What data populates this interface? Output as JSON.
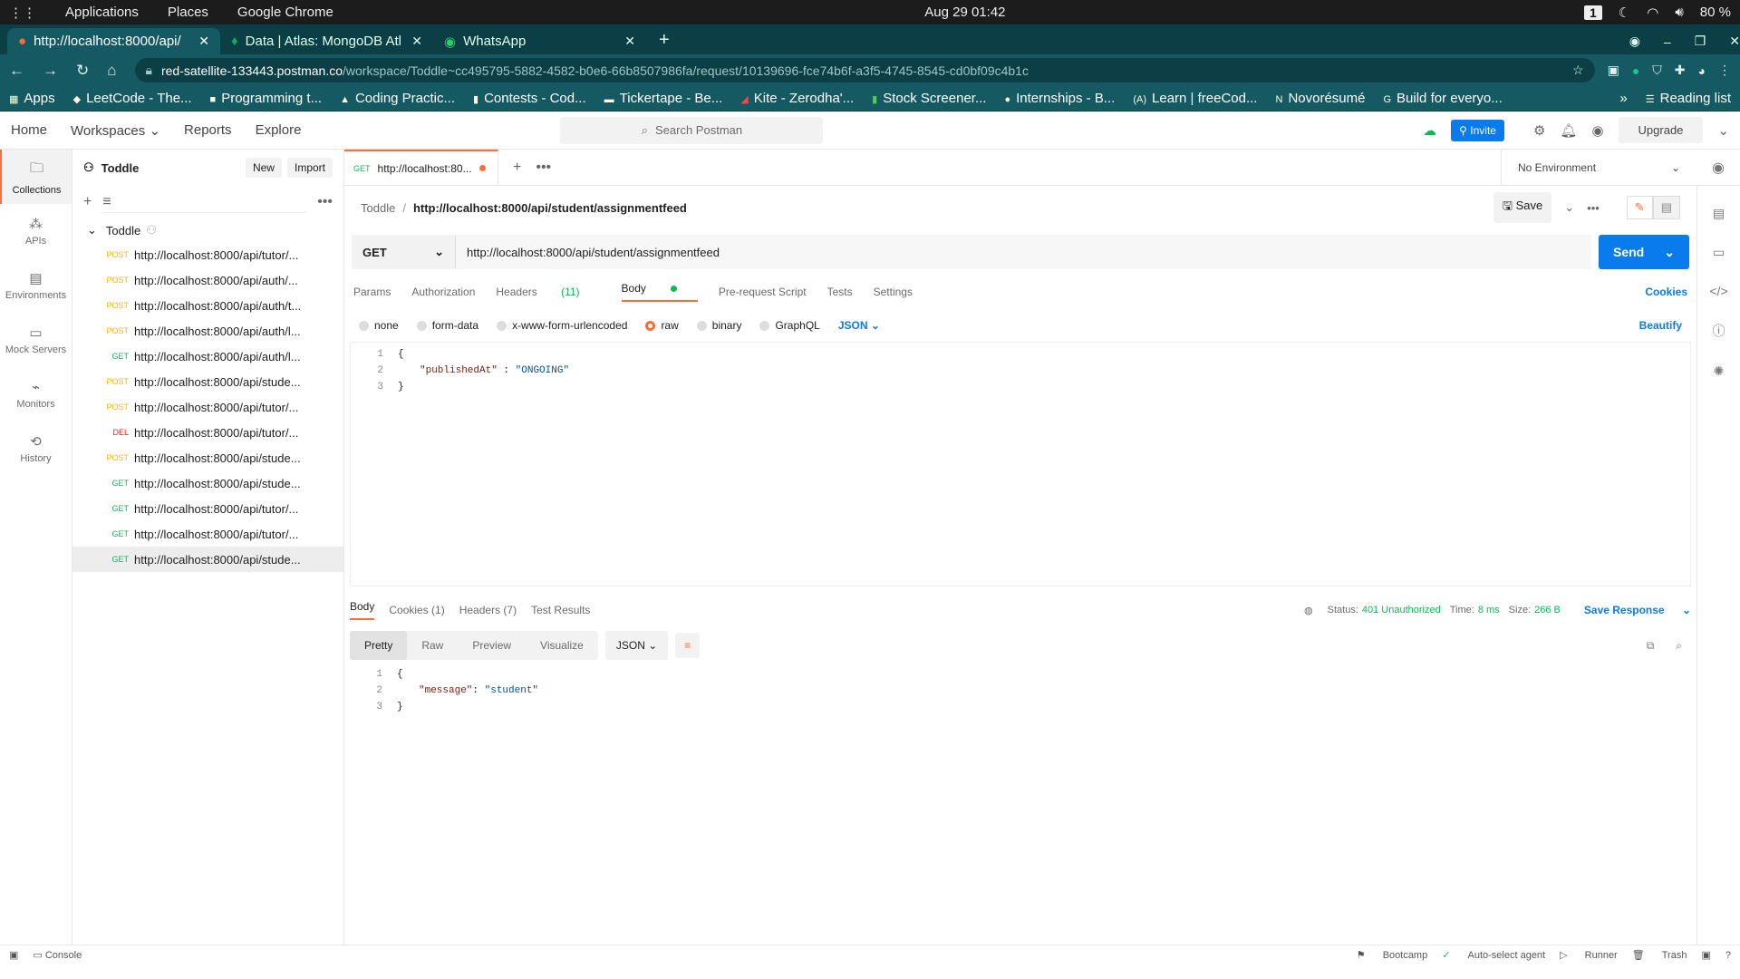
{
  "system": {
    "menu": [
      "Applications",
      "Places",
      "Google Chrome"
    ],
    "datetime": "Aug 29  01:42",
    "workspace": "1",
    "battery": "80 %"
  },
  "browser": {
    "tabs": [
      {
        "title": "http://localhost:8000/api/",
        "active": true
      },
      {
        "title": "Data | Atlas: MongoDB Atl",
        "active": false
      },
      {
        "title": "WhatsApp",
        "active": false
      }
    ],
    "url_host": "red-satellite-133443.postman.co",
    "url_path": "/workspace/Toddle~cc495795-5882-4582-b0e6-66b8507986fa/request/10139696-fce74b6f-a3f5-4745-8545-cd0bf09c4b1c",
    "bookmarks": [
      "Apps",
      "LeetCode - The...",
      "Programming t...",
      "Coding Practic...",
      "Contests - Cod...",
      "Tickertape - Be...",
      "Kite - Zerodha'...",
      "Stock Screener...",
      "Internships - B...",
      "Learn | freeCod...",
      "Novorésumé",
      "Build for everyo..."
    ],
    "reading_list": "Reading list"
  },
  "postman": {
    "nav": [
      "Home",
      "Workspaces",
      "Reports",
      "Explore"
    ],
    "search_placeholder": "Search Postman",
    "invite": "Invite",
    "upgrade": "Upgrade",
    "rail": [
      "Collections",
      "APIs",
      "Environments",
      "Mock Servers",
      "Monitors",
      "History"
    ],
    "workspace_name": "Toddle",
    "new_btn": "New",
    "import_btn": "Import",
    "collection_name": "Toddle",
    "requests": [
      {
        "method": "POST",
        "url": "http://localhost:8000/api/tutor/..."
      },
      {
        "method": "POST",
        "url": "http://localhost:8000/api/auth/..."
      },
      {
        "method": "POST",
        "url": "http://localhost:8000/api/auth/t..."
      },
      {
        "method": "POST",
        "url": "http://localhost:8000/api/auth/l..."
      },
      {
        "method": "GET",
        "url": "http://localhost:8000/api/auth/l..."
      },
      {
        "method": "POST",
        "url": "http://localhost:8000/api/stude..."
      },
      {
        "method": "POST",
        "url": "http://localhost:8000/api/tutor/..."
      },
      {
        "method": "DEL",
        "url": "http://localhost:8000/api/tutor/..."
      },
      {
        "method": "POST",
        "url": "http://localhost:8000/api/stude..."
      },
      {
        "method": "GET",
        "url": "http://localhost:8000/api/stude..."
      },
      {
        "method": "GET",
        "url": "http://localhost:8000/api/tutor/..."
      },
      {
        "method": "GET",
        "url": "http://localhost:8000/api/tutor/..."
      },
      {
        "method": "GET",
        "url": "http://localhost:8000/api/stude..."
      }
    ],
    "open_tab": {
      "method": "GET",
      "label": "http://localhost:80..."
    },
    "environment": "No Environment",
    "breadcrumb_collection": "Toddle",
    "breadcrumb_url": "http://localhost:8000/api/student/assignmentfeed",
    "save": "Save",
    "method": "GET",
    "url": "http://localhost:8000/api/student/assignmentfeed",
    "send": "Send",
    "req_tabs": {
      "params": "Params",
      "auth": "Authorization",
      "headers": "Headers",
      "headers_count": "(11)",
      "body": "Body",
      "prereq": "Pre-request Script",
      "tests": "Tests",
      "settings": "Settings",
      "cookies": "Cookies"
    },
    "body_types": [
      "none",
      "form-data",
      "x-www-form-urlencoded",
      "raw",
      "binary",
      "GraphQL"
    ],
    "body_format": "JSON",
    "beautify": "Beautify",
    "request_body": {
      "l1": "{",
      "l2_key": "\"publishedAt\"",
      "l2_sep": " : ",
      "l2_val": "\"ONGOING\"",
      "l3": "}"
    },
    "res_tabs": {
      "body": "Body",
      "cookies": "Cookies (1)",
      "headers": "Headers (7)",
      "tests": "Test Results"
    },
    "status_label": "Status:",
    "status_value": "401 Unauthorized",
    "time_label": "Time:",
    "time_value": "8 ms",
    "size_label": "Size:",
    "size_value": "266 B",
    "save_response": "Save Response",
    "views": [
      "Pretty",
      "Raw",
      "Preview",
      "Visualize"
    ],
    "res_format": "JSON",
    "response_body": {
      "l1": "{",
      "l2_key": "\"message\"",
      "l2_sep": ": ",
      "l2_val": "\"student\"",
      "l3": "}"
    },
    "footer_left": "Console",
    "footer_right": [
      "Bootcamp",
      "Auto-select agent",
      "Runner",
      "Trash"
    ]
  }
}
